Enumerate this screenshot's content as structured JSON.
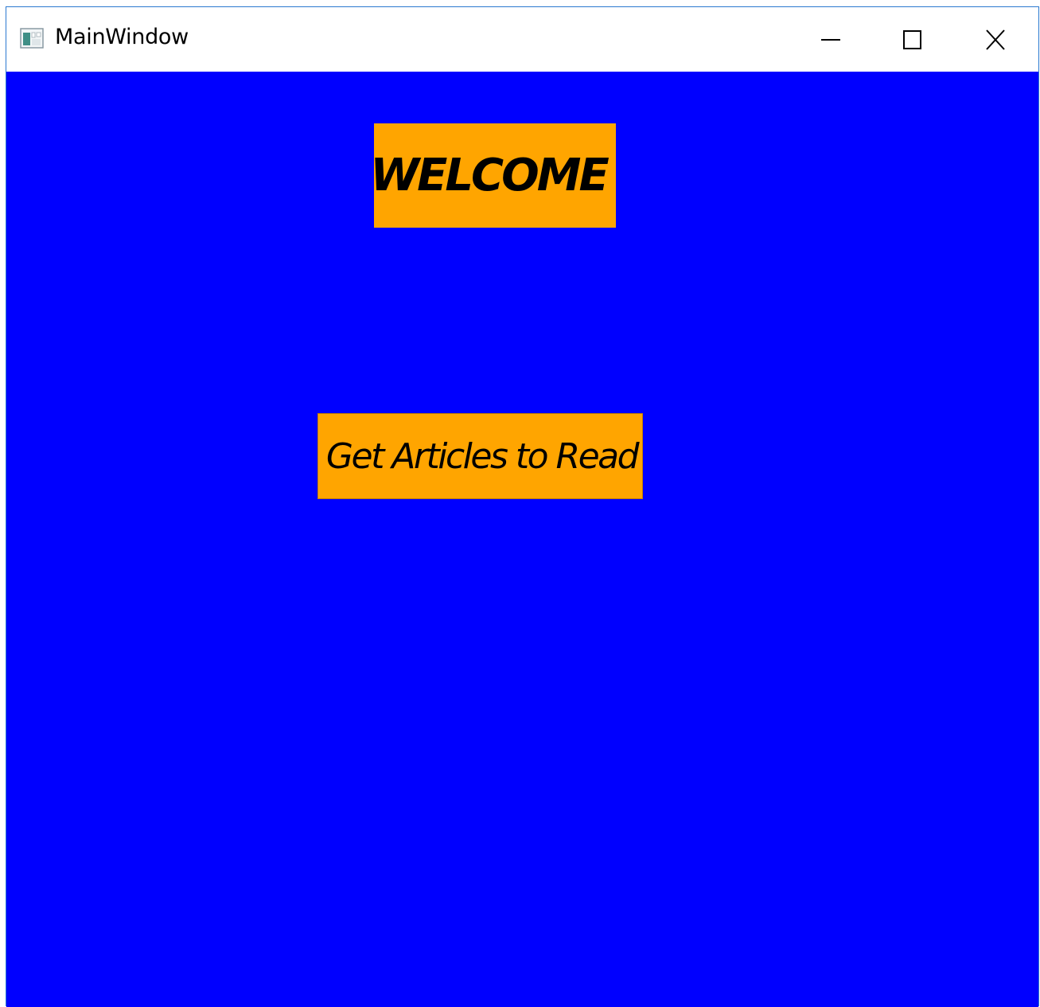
{
  "window": {
    "title": "MainWindow",
    "icon": "app-window-icon",
    "controls": {
      "minimize_icon": "minimize-icon",
      "maximize_icon": "maximize-icon",
      "close_icon": "close-icon"
    }
  },
  "main": {
    "background_color": "#0000ff",
    "welcome_label": {
      "text": "WELCOME",
      "background_color": "#ffa500"
    },
    "articles_button": {
      "label": "Get Articles to Read",
      "background_color": "#ffa500"
    }
  }
}
